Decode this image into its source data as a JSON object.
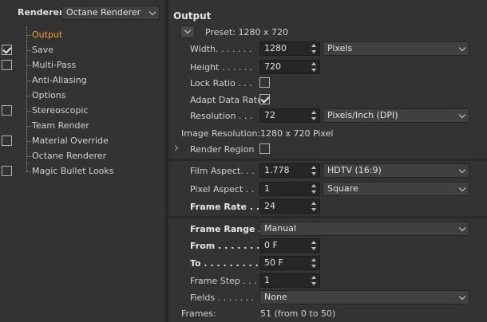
{
  "left_panel": {
    "renderer_label": "Renderer",
    "renderer_value": "Octane Renderer",
    "tree": [
      {
        "label": "Output",
        "checkbox": false,
        "checked": false,
        "active": true
      },
      {
        "label": "Save",
        "checkbox": true,
        "checked": true,
        "active": false
      },
      {
        "label": "Multi-Pass",
        "checkbox": true,
        "checked": false,
        "active": false
      },
      {
        "label": "Anti-Aliasing",
        "checkbox": false,
        "checked": false,
        "active": false
      },
      {
        "label": "Options",
        "checkbox": false,
        "checked": false,
        "active": false
      },
      {
        "label": "Stereoscopic",
        "checkbox": true,
        "checked": false,
        "active": false
      },
      {
        "label": "Team Render",
        "checkbox": false,
        "checked": false,
        "active": false
      },
      {
        "label": "Material Override",
        "checkbox": true,
        "checked": false,
        "active": false
      },
      {
        "label": "Octane Renderer",
        "checkbox": false,
        "checked": false,
        "active": false
      },
      {
        "label": "Magic Bullet Looks",
        "checkbox": true,
        "checked": false,
        "active": false
      }
    ]
  },
  "output": {
    "title": "Output",
    "preset": "Preset: 1280 x 720",
    "width_label": "Width. . . . . . .",
    "width_value": "1280",
    "width_unit": "Pixels",
    "height_label": "Height . . . . . .",
    "height_value": "720",
    "lock_ratio_label": "Lock Ratio . . .",
    "lock_ratio_checked": false,
    "adapt_label": "Adapt Data Rate",
    "adapt_checked": true,
    "resolution_label": "Resolution . . .",
    "resolution_value": "72",
    "resolution_unit": "Pixels/Inch (DPI)",
    "image_resolution_label": "Image Resolution:",
    "image_resolution_value": "1280 x 720 Pixel",
    "render_region_label": "Render Region",
    "render_region_checked": false,
    "film_aspect_label": "Film Aspect. . .",
    "film_aspect_value": "1.778",
    "film_aspect_preset": "HDTV (16:9)",
    "pixel_aspect_label": "Pixel Aspect . .",
    "pixel_aspect_value": "1",
    "pixel_aspect_preset": "Square",
    "frame_rate_label": "Frame Rate . .",
    "frame_rate_value": "24",
    "frame_range_label": "Frame Range .",
    "frame_range_value": "Manual",
    "from_label": "From . . . . . . .",
    "from_value": "0 F",
    "to_label": "To . . . . . . . . .",
    "to_value": "50 F",
    "frame_step_label": "Frame Step . . .",
    "frame_step_value": "1",
    "fields_label": "Fields . . . . . . .",
    "fields_value": "None",
    "frames_label": "Frames:",
    "frames_value": "51 (from 0 to 50)"
  }
}
